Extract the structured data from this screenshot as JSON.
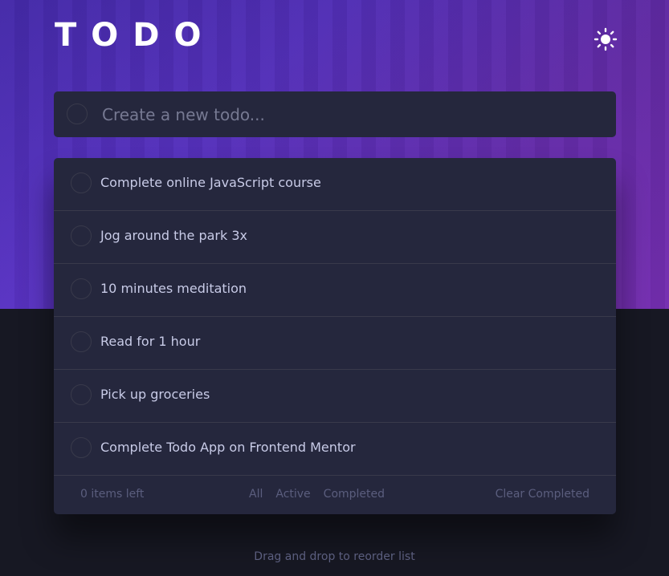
{
  "header": {
    "title": "TODO",
    "theme_icon": "sun-icon"
  },
  "new_todo": {
    "placeholder": "Create a new todo...",
    "value": ""
  },
  "todos": [
    {
      "text": "Complete online JavaScript course",
      "completed": false
    },
    {
      "text": "Jog around the park 3x",
      "completed": false
    },
    {
      "text": "10 minutes meditation",
      "completed": false
    },
    {
      "text": "Read for 1 hour",
      "completed": false
    },
    {
      "text": "Pick up groceries",
      "completed": false
    },
    {
      "text": "Complete Todo App on Frontend Mentor",
      "completed": false
    }
  ],
  "footer": {
    "items_left": "0 items left",
    "filters": [
      "All",
      "Active",
      "Completed"
    ],
    "clear": "Clear Completed"
  },
  "hint": "Drag and drop to reorder list",
  "colors": {
    "card": "#25273d",
    "background": "#171823",
    "text": "#c8cbe7",
    "muted": "#5b5e7e",
    "divider": "#393a4b",
    "gradient_start": "#5a35c7",
    "gradient_end": "#7a2fb0"
  }
}
